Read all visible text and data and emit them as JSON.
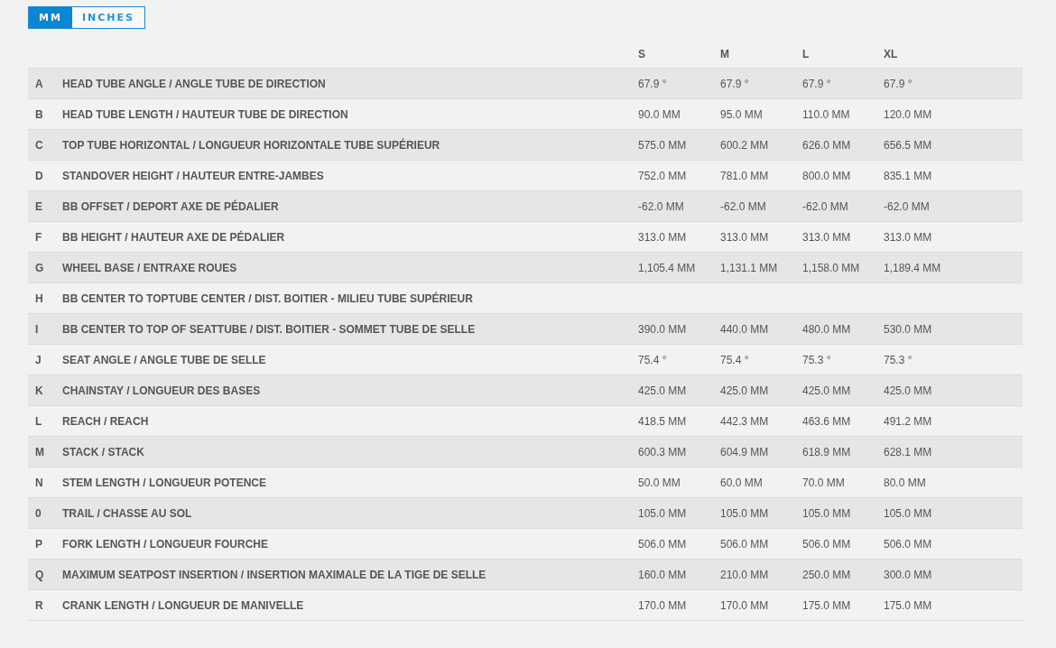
{
  "unit_toggle": [
    {
      "label": "MM",
      "selected": true
    },
    {
      "label": "INCHES",
      "selected": false
    }
  ],
  "table": {
    "columns": [
      "S",
      "M",
      "L",
      "XL"
    ],
    "rows": [
      {
        "letter": "A",
        "label": "HEAD TUBE ANGLE / ANGLE TUBE DE DIRECTION",
        "values": [
          "67.9 °",
          "67.9 °",
          "67.9 °",
          "67.9 °"
        ]
      },
      {
        "letter": "B",
        "label": "HEAD TUBE LENGTH / HAUTEUR TUBE DE DIRECTION",
        "values": [
          "90.0 MM",
          "95.0 MM",
          "110.0 MM",
          "120.0 MM"
        ]
      },
      {
        "letter": "C",
        "label": "TOP TUBE HORIZONTAL / LONGUEUR HORIZONTALE TUBE SUPÉRIEUR",
        "values": [
          "575.0 MM",
          "600.2 MM",
          "626.0 MM",
          "656.5 MM"
        ]
      },
      {
        "letter": "D",
        "label": "STANDOVER HEIGHT / HAUTEUR ENTRE-JAMBES",
        "values": [
          "752.0 MM",
          "781.0 MM",
          "800.0 MM",
          "835.1 MM"
        ]
      },
      {
        "letter": "E",
        "label": "BB OFFSET / DEPORT AXE DE PÉDALIER",
        "values": [
          "-62.0 MM",
          "-62.0 MM",
          "-62.0 MM",
          "-62.0 MM"
        ]
      },
      {
        "letter": "F",
        "label": "BB HEIGHT / HAUTEUR AXE DE PÉDALIER",
        "values": [
          "313.0 MM",
          "313.0 MM",
          "313.0 MM",
          "313.0 MM"
        ]
      },
      {
        "letter": "G",
        "label": "WHEEL BASE / ENTRAXE ROUES",
        "values": [
          "1,105.4 MM",
          "1,131.1 MM",
          "1,158.0 MM",
          "1,189.4 MM"
        ]
      },
      {
        "letter": "H",
        "label": "BB CENTER TO TOPTUBE CENTER / DIST. BOITIER - MILIEU TUBE SUPÉRIEUR",
        "values": []
      },
      {
        "letter": "I",
        "label": "BB CENTER TO TOP OF SEATTUBE / DIST. BOITIER - SOMMET TUBE DE SELLE",
        "values": [
          "390.0 MM",
          "440.0 MM",
          "480.0 MM",
          "530.0 MM"
        ]
      },
      {
        "letter": "J",
        "label": "SEAT ANGLE / ANGLE TUBE DE SELLE",
        "values": [
          "75.4 °",
          "75.4 °",
          "75.3 °",
          "75.3 °"
        ]
      },
      {
        "letter": "K",
        "label": "CHAINSTAY / LONGUEUR DES BASES",
        "values": [
          "425.0 MM",
          "425.0 MM",
          "425.0 MM",
          "425.0 MM"
        ]
      },
      {
        "letter": "L",
        "label": "REACH / REACH",
        "values": [
          "418.5 MM",
          "442.3 MM",
          "463.6 MM",
          "491.2 MM"
        ]
      },
      {
        "letter": "M",
        "label": "STACK / STACK",
        "values": [
          "600.3 MM",
          "604.9 MM",
          "618.9 MM",
          "628.1 MM"
        ]
      },
      {
        "letter": "N",
        "label": "STEM LENGTH / LONGUEUR POTENCE",
        "values": [
          "50.0 MM",
          "60.0 MM",
          "70.0 MM",
          "80.0 MM"
        ]
      },
      {
        "letter": "0",
        "label": "TRAIL / CHASSE AU SOL",
        "values": [
          "105.0 MM",
          "105.0 MM",
          "105.0 MM",
          "105.0 MM"
        ]
      },
      {
        "letter": "P",
        "label": "FORK LENGTH / LONGUEUR FOURCHE",
        "values": [
          "506.0 MM",
          "506.0 MM",
          "506.0 MM",
          "506.0 MM"
        ]
      },
      {
        "letter": "Q",
        "label": "MAXIMUM SEATPOST INSERTION / INSERTION MAXIMALE DE LA TIGE DE SELLE",
        "values": [
          "160.0 MM",
          "210.0 MM",
          "250.0 MM",
          "300.0 MM"
        ]
      },
      {
        "letter": "R",
        "label": "CRANK LENGTH / LONGUEUR DE MANIVELLE",
        "values": [
          "170.0 MM",
          "170.0 MM",
          "175.0 MM",
          "175.0 MM"
        ]
      }
    ]
  }
}
